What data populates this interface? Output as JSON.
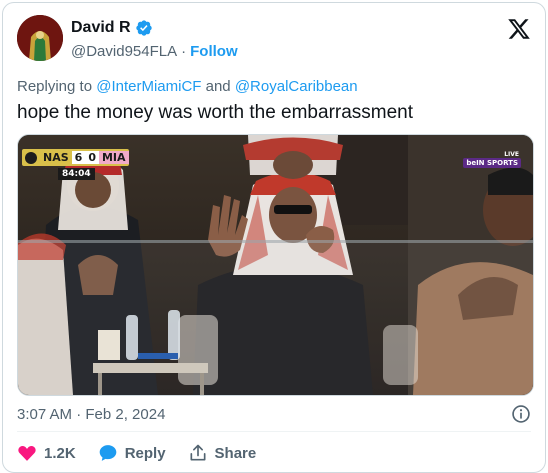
{
  "author": {
    "display_name": "David R",
    "handle": "@David954FLA",
    "separator": "·",
    "follow_label": "Follow",
    "verified_color": "#1d9bf0"
  },
  "reply": {
    "prefix": "Replying to",
    "mention1": "@InterMiamiCF",
    "conjunction": "and",
    "mention2": "@RoyalCaribbean"
  },
  "tweet": {
    "text": "hope the money was worth the embarrassment",
    "timestamp": "3:07 AM · Feb 2, 2024"
  },
  "media": {
    "scorebug": {
      "team1": "NAS",
      "score1": "6",
      "score2": "0",
      "team2": "MIA",
      "clock": "84:04"
    },
    "broadcaster_tag": "LIVE",
    "broadcaster": "beIN SPORTS"
  },
  "actions": {
    "likes": "1.2K",
    "reply_label": "Reply",
    "share_label": "Share"
  },
  "icons": {
    "avatar": "avatar-image",
    "verified": "verified-badge-icon",
    "x_logo": "x-logo-icon",
    "info": "info-icon",
    "like": "heart-icon",
    "reply": "reply-bubble-icon",
    "share": "share-icon"
  },
  "colors": {
    "accent": "#1d9bf0",
    "like": "#f91880",
    "muted": "#536471",
    "text": "#0f1419"
  }
}
